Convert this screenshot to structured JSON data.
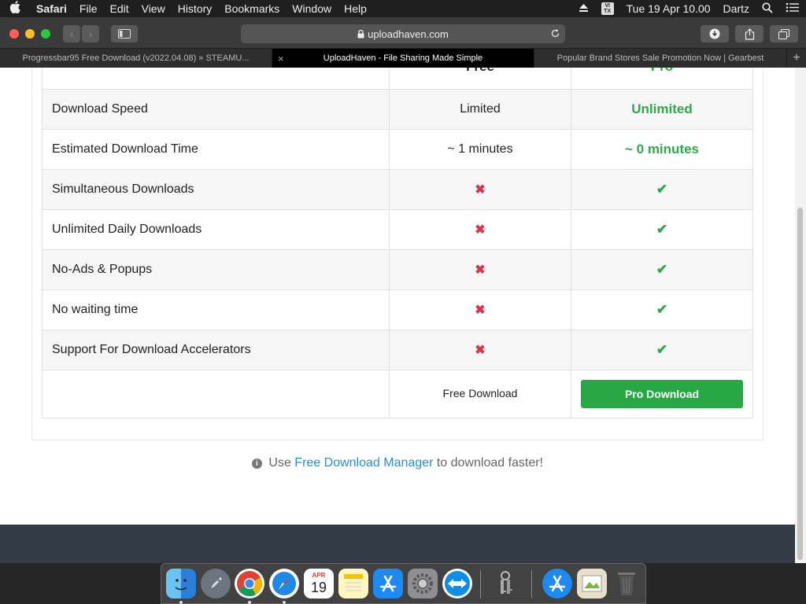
{
  "menubar": {
    "apple": "",
    "app": "Safari",
    "items": [
      "File",
      "Edit",
      "View",
      "History",
      "Bookmarks",
      "Window",
      "Help"
    ],
    "input_badge": "VI TX",
    "clock": "Tue 19 Apr  10.00",
    "user": "Dartz"
  },
  "browser": {
    "url": "uploadhaven.com",
    "tabs": [
      "Progressbar95 Free Download (v2022.04.08) » STEAMU...",
      "UploadHaven - File Sharing Made Simple",
      "Popular Brand Stores Sale Promotion Now | Gearbest"
    ]
  },
  "table": {
    "headers": [
      "",
      "Free",
      "Pro"
    ],
    "rows": [
      {
        "feature": "Download Speed",
        "free": "Limited",
        "pro": "Unlimited"
      },
      {
        "feature": "Estimated Download Time",
        "free": "~ 1 minutes",
        "pro": "~ 0 minutes"
      },
      {
        "feature": "Simultaneous Downloads",
        "free": "✖",
        "pro": "✔"
      },
      {
        "feature": "Unlimited Daily Downloads",
        "free": "✖",
        "pro": "✔"
      },
      {
        "feature": "No-Ads & Popups",
        "free": "✖",
        "pro": "✔"
      },
      {
        "feature": "No waiting time",
        "free": "✖",
        "pro": "✔"
      },
      {
        "feature": "Support For Download Accelerators",
        "free": "✖",
        "pro": "✔"
      }
    ],
    "free_button": "Free Download",
    "pro_button": "Pro Download"
  },
  "note": {
    "prefix": "Use",
    "link": "Free Download Manager",
    "suffix": "to download faster!"
  },
  "dock": {
    "calendar_month": "APR",
    "calendar_day": "19"
  },
  "colors": {
    "accent_green": "#28a745",
    "link_blue": "#2a8ec9",
    "cross_red": "#d9364e"
  }
}
